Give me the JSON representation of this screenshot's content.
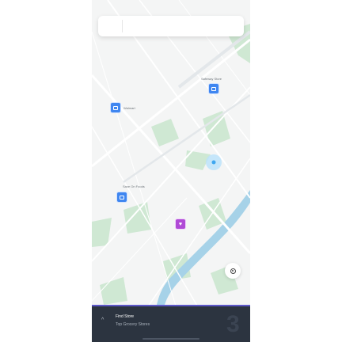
{
  "search": {
    "placeholder": "",
    "value": ""
  },
  "map": {
    "road_label_top": "",
    "stores": [
      {
        "name": "Safeway Store",
        "kind": "grocery",
        "color": "#3f86f0"
      },
      {
        "name": "Walmart",
        "kind": "grocery",
        "color": "#3f86f0"
      },
      {
        "name": "Save On Foods",
        "kind": "grocery",
        "color": "#3f86f0"
      },
      {
        "name": "",
        "kind": "favorite",
        "color": "#b04ad6"
      }
    ]
  },
  "location_button": {
    "icon": "locate-icon"
  },
  "panel": {
    "title": "Find Store",
    "subtitle": "Top Grocery Stores",
    "count": "3",
    "accent": "#5d58c9",
    "background": "#2c3440"
  }
}
